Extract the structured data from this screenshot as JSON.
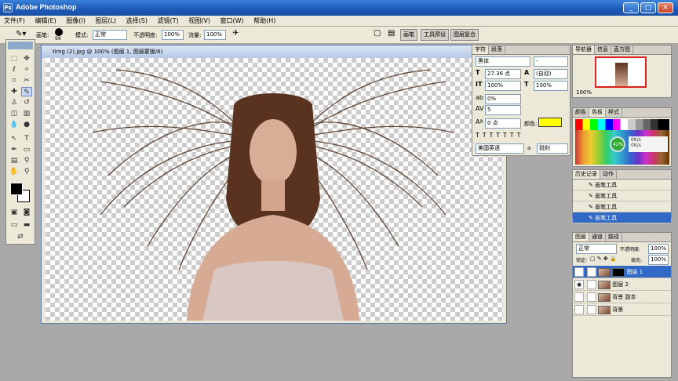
{
  "window": {
    "title": "Adobe Photoshop",
    "minimize": "_",
    "maximize": "□",
    "close": "×"
  },
  "menu": [
    "文件(F)",
    "编辑(E)",
    "图像(I)",
    "图层(L)",
    "选择(S)",
    "滤镜(T)",
    "视图(V)",
    "窗口(W)",
    "帮助(H)"
  ],
  "options": {
    "brush_label": "画笔:",
    "brush_size": "99",
    "mode_label": "模式:",
    "mode_value": "正常",
    "opacity_label": "不透明度:",
    "opacity_value": "100%",
    "flow_label": "流量:",
    "flow_value": "100%",
    "tabs": [
      "画笔",
      "工具预设",
      "图层复合"
    ]
  },
  "document": {
    "title": "timg (2).jpg @ 100% (图层 1, 图层蒙版/8)"
  },
  "character": {
    "tabs": [
      "字符",
      "段落"
    ],
    "font": "黑体",
    "style": "-",
    "size": "27.36 点",
    "leading": "(自动)",
    "vscale": "100%",
    "hscale": "100%",
    "tracking": "0%",
    "kerning": "5",
    "baseline": "0 点",
    "color_label": "颜色:",
    "color": "#ffff00",
    "language": "美国英语",
    "aa_label": "a",
    "antialias": "锐利"
  },
  "navigator": {
    "tabs": [
      "导航器",
      "信息",
      "直方图"
    ],
    "zoom": "100%"
  },
  "swatches": {
    "tabs": [
      "颜色",
      "色板",
      "样式"
    ],
    "badge": "42%",
    "rate1": "0K/s",
    "rate2": "0K/s"
  },
  "history": {
    "tabs": [
      "历史记录",
      "动作"
    ],
    "items": [
      "画笔工具",
      "画笔工具",
      "画笔工具",
      "画笔工具"
    ]
  },
  "layers": {
    "tabs": [
      "图层",
      "通道",
      "路径"
    ],
    "mode": "正常",
    "opacity_label": "不透明度:",
    "opacity": "100%",
    "lock_label": "锁定:",
    "fill_label": "填充:",
    "fill": "100%",
    "items": [
      "图层 1",
      "图层 2",
      "背景 副本",
      "背景"
    ]
  }
}
